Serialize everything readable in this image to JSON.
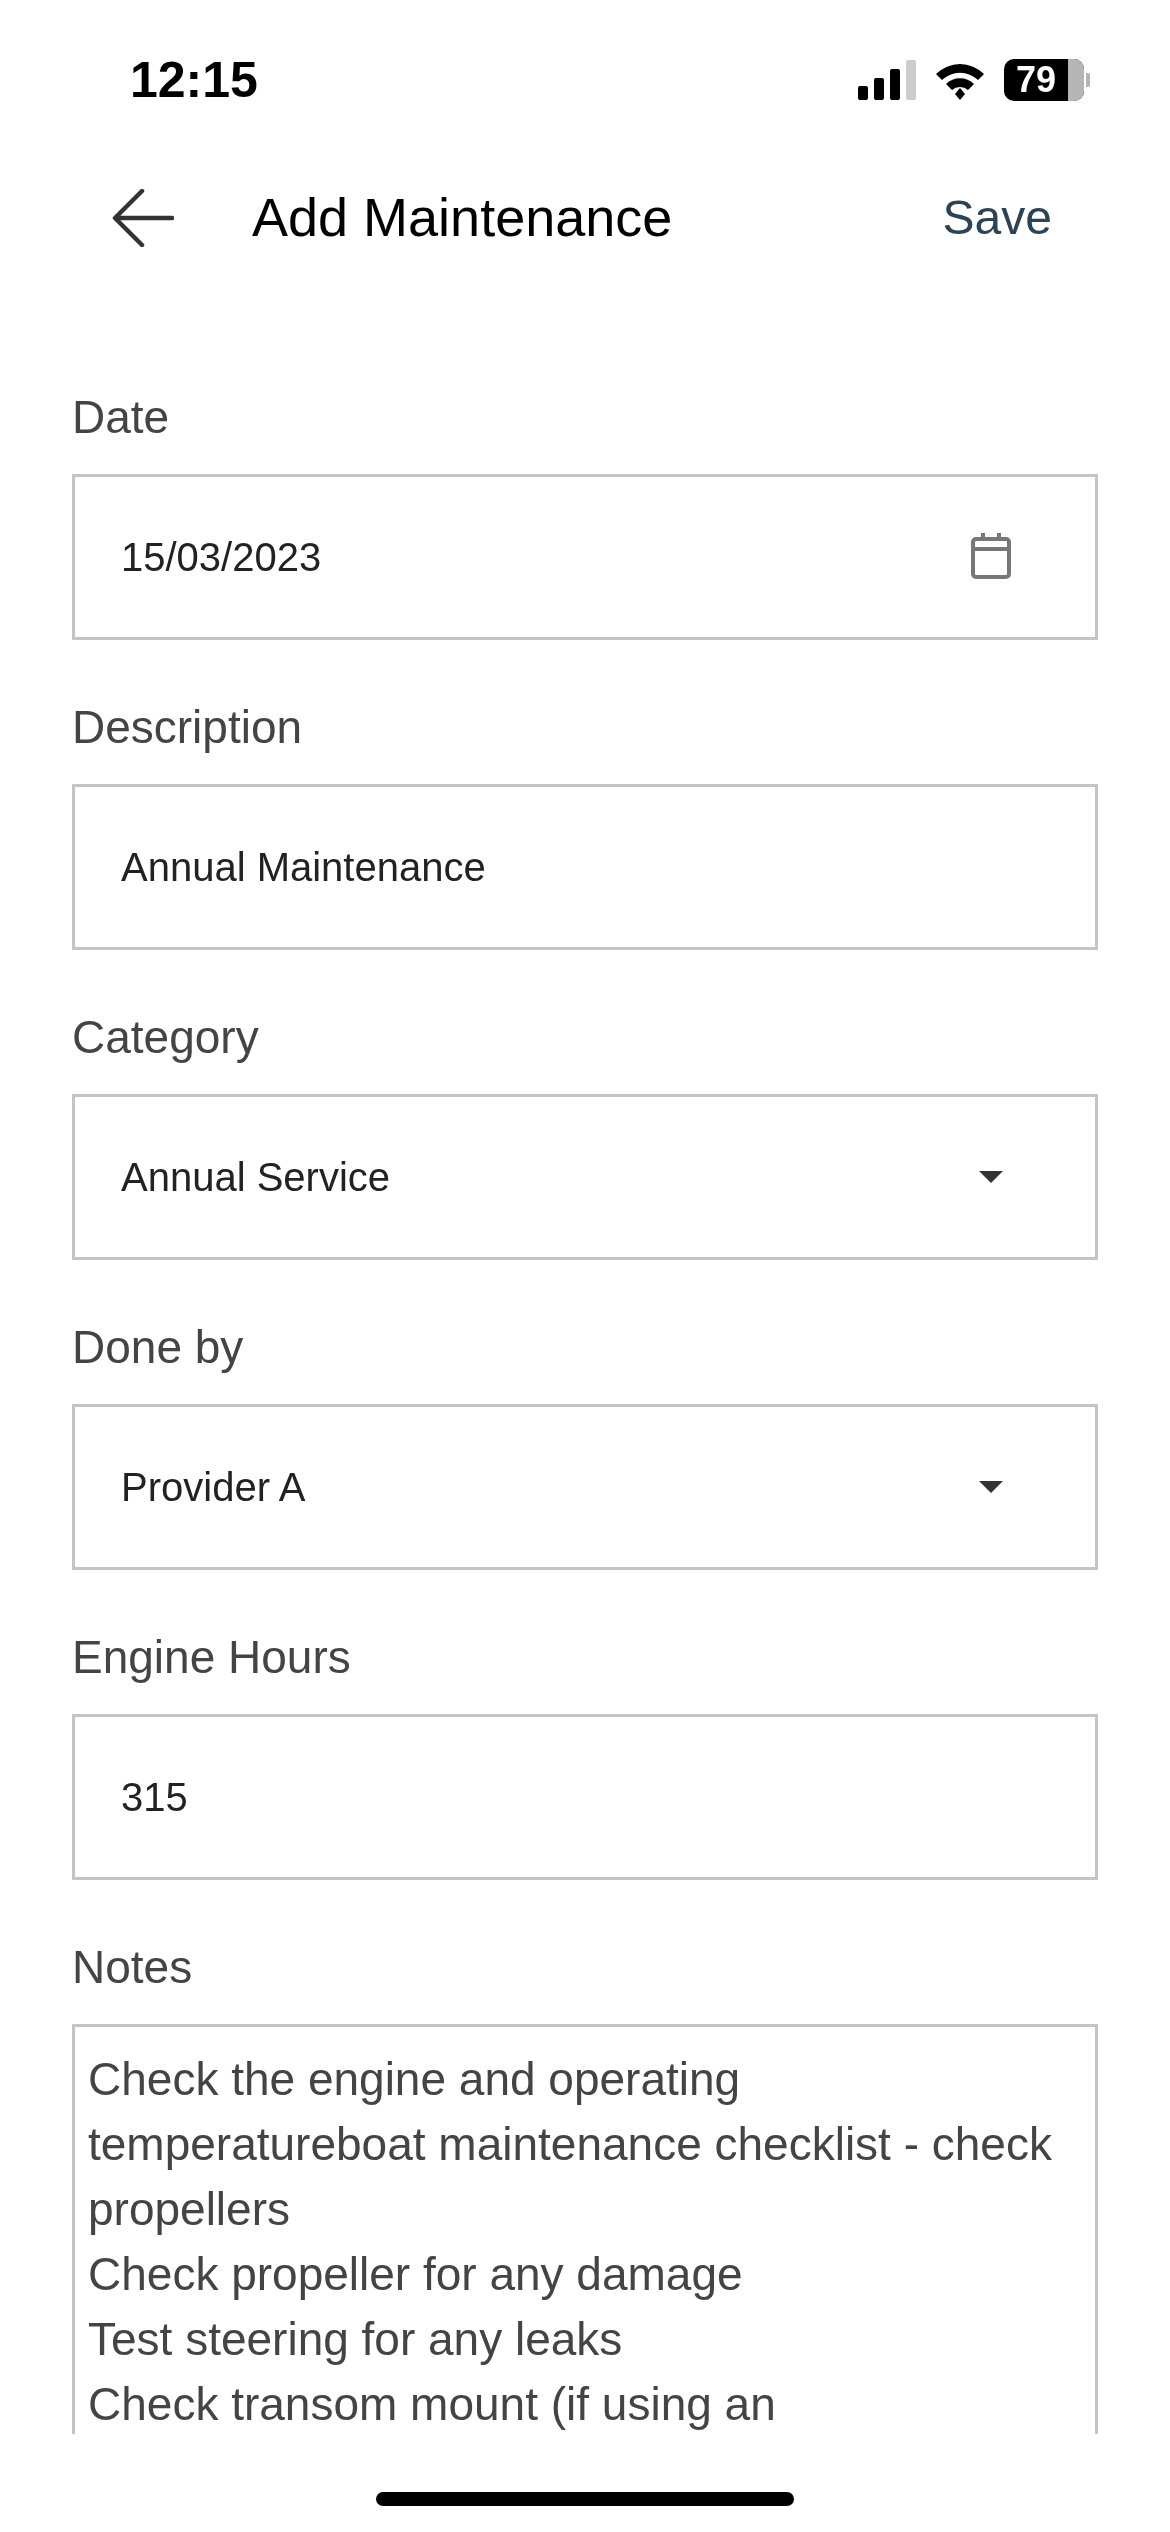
{
  "status_bar": {
    "time": "12:15",
    "battery": "79"
  },
  "header": {
    "title": "Add Maintenance",
    "action": "Save"
  },
  "fields": [
    {
      "kind": "date",
      "label": "Date",
      "value": "15/03/2023"
    },
    {
      "kind": "text",
      "label": "Description",
      "value": "Annual Maintenance"
    },
    {
      "kind": "select",
      "label": "Category",
      "value": "Annual Service"
    },
    {
      "kind": "select",
      "label": "Done by",
      "value": "Provider A"
    },
    {
      "kind": "text",
      "label": "Engine Hours",
      "value": "315"
    }
  ],
  "notes": {
    "label": "Notes",
    "value": "Check the engine and operating temperatureboat maintenance checklist - check propellers\nCheck propeller for any damage\nTest steering for any leaks\nCheck transom mount (if using an"
  }
}
